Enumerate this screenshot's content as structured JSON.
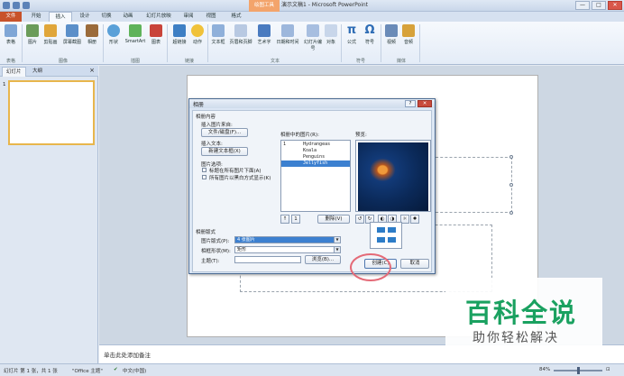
{
  "window": {
    "title": "演示文稿1 - Microsoft PowerPoint",
    "context_tab": "绘图工具",
    "controls": [
      "—",
      "□",
      "✕"
    ]
  },
  "tabs": [
    {
      "label": "文件",
      "kind": "file"
    },
    {
      "label": "开始"
    },
    {
      "label": "插入",
      "active": true
    },
    {
      "label": "设计"
    },
    {
      "label": "切换"
    },
    {
      "label": "动画"
    },
    {
      "label": "幻灯片放映"
    },
    {
      "label": "审阅"
    },
    {
      "label": "视图"
    },
    {
      "label": "格式"
    }
  ],
  "ribbon": {
    "buttons": [
      "表格",
      "图片",
      "剪贴画",
      "屏幕截图",
      "相册",
      "形状",
      "SmartArt",
      "图表",
      "超链接",
      "动作",
      "文本框",
      "页眉和页脚",
      "艺术字",
      "日期和时间",
      "幻灯片编号",
      "对象",
      "公式",
      "符号",
      "视频",
      "音频"
    ],
    "groups": [
      "表格",
      "图像",
      "插图",
      "链接",
      "文本",
      "符号",
      "媒体"
    ],
    "accent": "#2f6db5"
  },
  "left_pane": {
    "tabs": [
      "幻灯片",
      "大纲"
    ],
    "close": "×",
    "thumb_number": "1"
  },
  "notes": {
    "placeholder": "单击此处添加备注"
  },
  "status": {
    "slide_info": "幻灯片 第 1 张，共 1 张",
    "theme": "\"Office 主题\"",
    "language": "中文(中国)",
    "zoom": "84%"
  },
  "dialog": {
    "title": "相册",
    "help": "?",
    "close": "✕",
    "album_content": "相册内容",
    "insert_from": "插入图片来自:",
    "file_disk_button": "文件/磁盘(F)...",
    "insert_text": "插入文本:",
    "new_textbox_button": "新建文本框(X)",
    "picture_options": "图片选项:",
    "option_captions": "标题在所有图片下面(A)",
    "option_bw": "所有图片以黑白方式显示(K)",
    "pictures_in_album": "相册中的图片(R):",
    "pictures": [
      {
        "num": "1",
        "name": "Hydrangeas"
      },
      {
        "num": "",
        "name": "Koala"
      },
      {
        "num": "",
        "name": "Penguins"
      },
      {
        "num": "",
        "name": "Jellyfish",
        "selected": true
      }
    ],
    "preview_label": "预览:",
    "order_up": "↑",
    "order_down": "↓",
    "order_value": "1",
    "delete_button": "删除(V)",
    "album_layout": "相册版式",
    "picture_layout_label": "图片版式(P):",
    "picture_layout_value": "4 张图片",
    "frame_shape_label": "相框形状(M):",
    "frame_shape_value": "矩形",
    "theme_label": "主题(T):",
    "theme_value": "",
    "browse_button": "浏览(B)...",
    "create_button": "创建(C)",
    "cancel_button": "取消"
  },
  "watermark": {
    "title": "百科全说",
    "subtitle": "助你轻松解决"
  }
}
